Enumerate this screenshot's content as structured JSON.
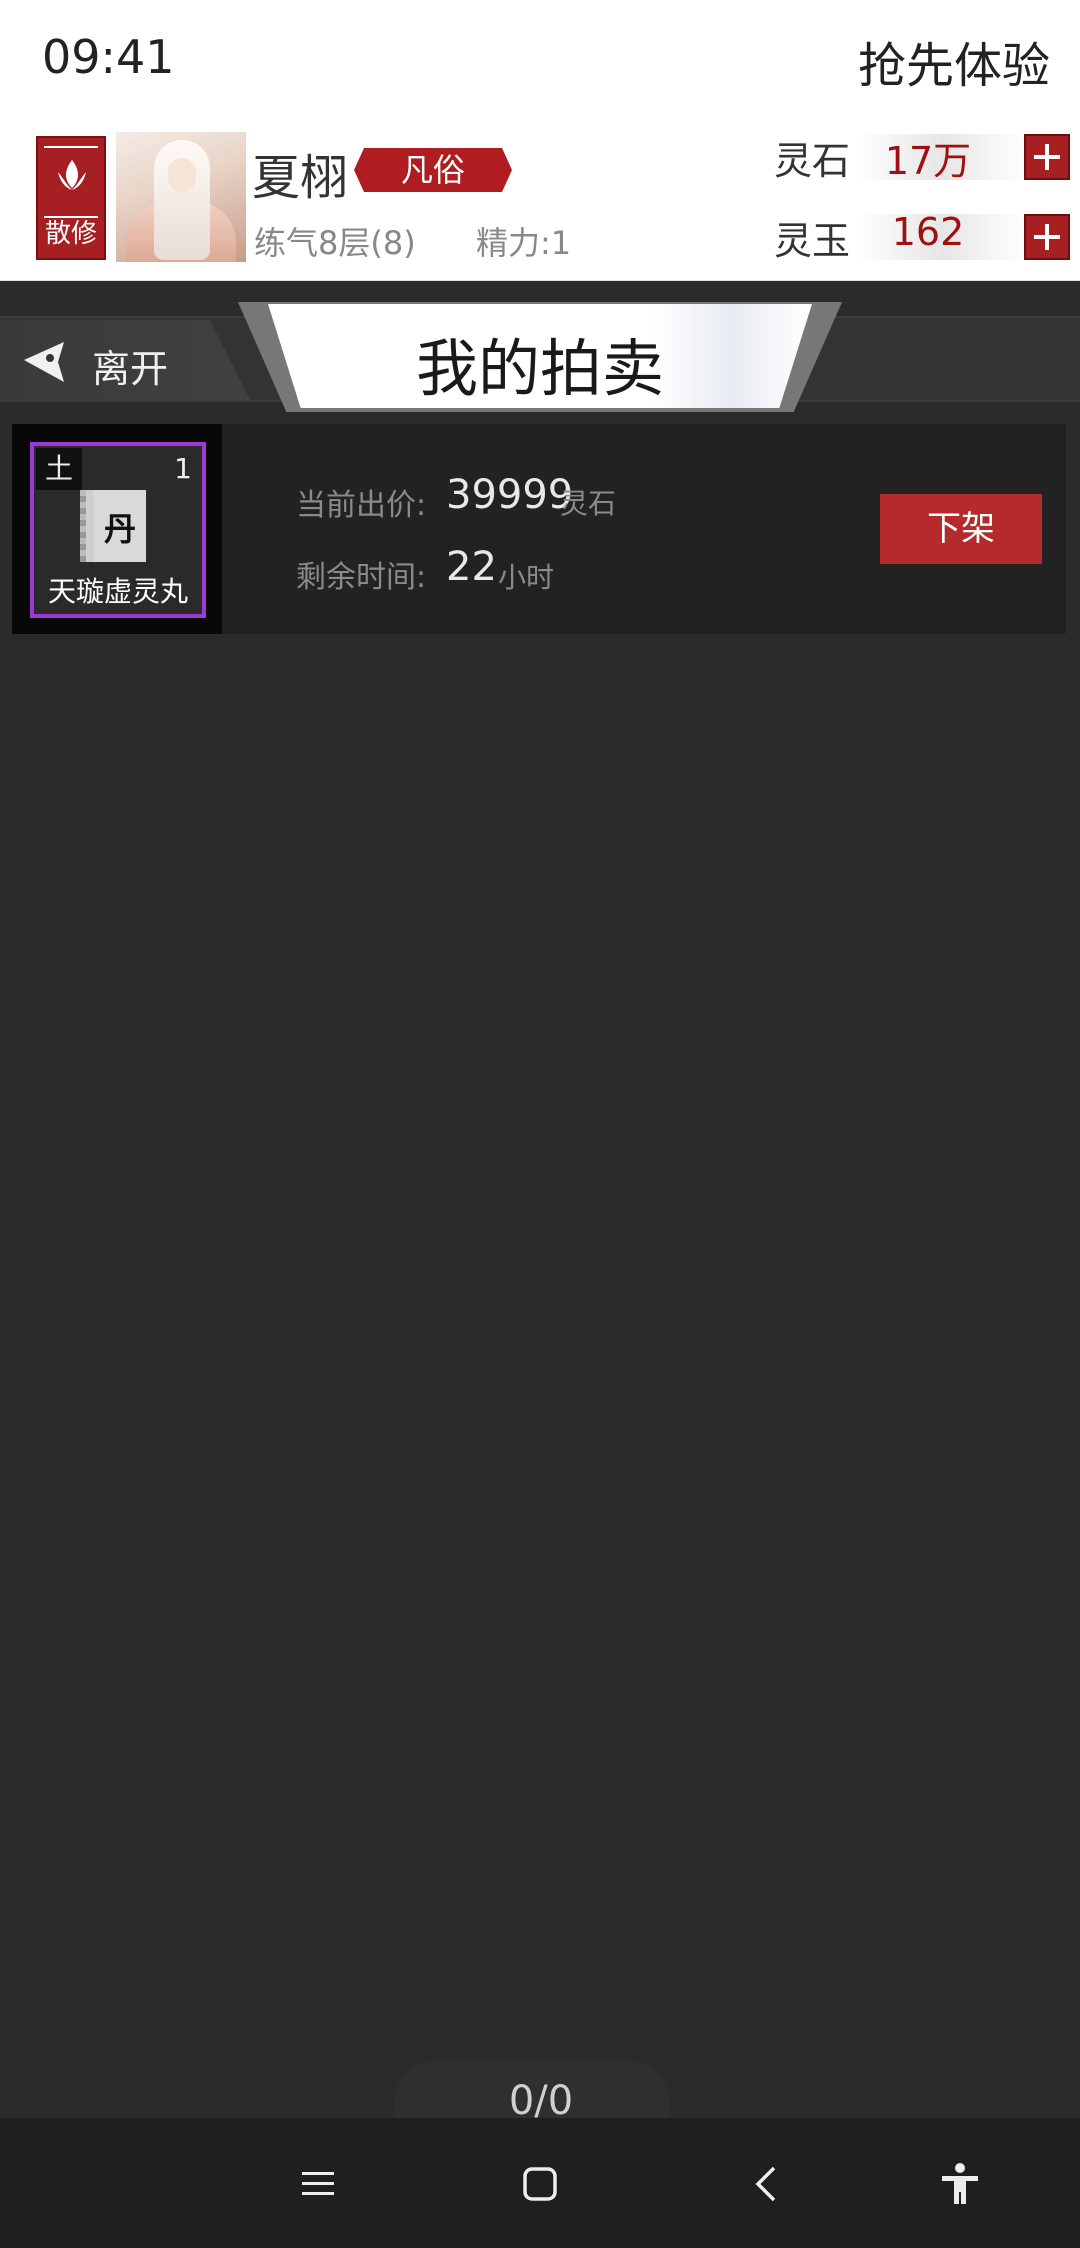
{
  "status_bar": {
    "time": "09:41",
    "early_access_label": "抢先体验"
  },
  "player": {
    "sect_badge": "散修",
    "name": "夏栩",
    "rank": "凡俗",
    "realm": "练气8层(8)",
    "stamina": "精力:1"
  },
  "currencies": [
    {
      "label": "灵石",
      "value": "17万"
    },
    {
      "label": "灵玉",
      "value": "162"
    }
  ],
  "nav": {
    "back_label": "离开",
    "title": "我的拍卖"
  },
  "listing": {
    "item": {
      "element": "土",
      "quantity": "1",
      "icon_glyph": "丹",
      "name": "天璇虚灵丸"
    },
    "bid_label": "当前出价:",
    "bid_value": "39999",
    "bid_unit": "灵石",
    "time_label": "剩余时间:",
    "time_value": "22",
    "time_unit": "小时",
    "delist_label": "下架"
  },
  "pager": {
    "text": "0/0"
  },
  "system_nav": {
    "icons": [
      "menu-icon",
      "home-icon",
      "back-icon",
      "accessibility-icon"
    ]
  },
  "colors": {
    "accent_red": "#b01d20",
    "item_rarity_purple": "#9b3ad6",
    "background": "#2b2b2b"
  }
}
